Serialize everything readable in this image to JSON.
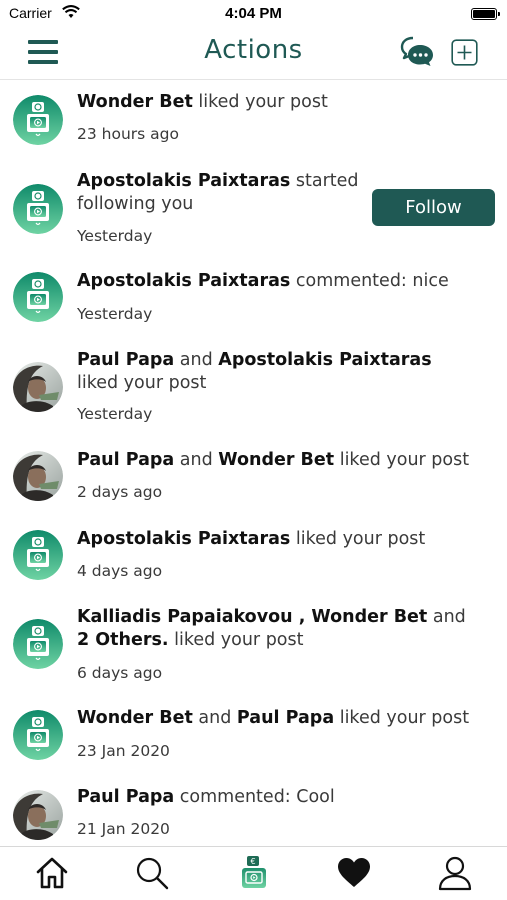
{
  "status_bar": {
    "carrier": "Carrier",
    "time": "4:04 PM"
  },
  "nav": {
    "title": "Actions"
  },
  "notifications": [
    {
      "avatar": "app-logo",
      "parts": [
        {
          "text": "Wonder Bet",
          "bold": true
        },
        {
          "text": " liked your post",
          "bold": false
        }
      ],
      "time": "23 hours ago"
    },
    {
      "avatar": "app-logo",
      "parts": [
        {
          "text": "Apostolakis Paixtaras",
          "bold": true
        },
        {
          "text": " started following you",
          "bold": false
        }
      ],
      "time": "Yesterday",
      "action": "Follow"
    },
    {
      "avatar": "app-logo",
      "parts": [
        {
          "text": "Apostolakis Paixtaras",
          "bold": true
        },
        {
          "text": " commented: nice",
          "bold": false
        }
      ],
      "time": "Yesterday"
    },
    {
      "avatar": "user-photo",
      "parts": [
        {
          "text": "Paul Papa",
          "bold": true
        },
        {
          "text": " and ",
          "bold": false
        },
        {
          "text": "Apostolakis Paixtaras",
          "bold": true
        },
        {
          "text": " liked your post",
          "bold": false
        }
      ],
      "time": "Yesterday"
    },
    {
      "avatar": "user-photo",
      "parts": [
        {
          "text": "Paul Papa",
          "bold": true
        },
        {
          "text": " and ",
          "bold": false
        },
        {
          "text": "Wonder Bet",
          "bold": true
        },
        {
          "text": " liked your post",
          "bold": false
        }
      ],
      "time": "2 days ago"
    },
    {
      "avatar": "app-logo",
      "parts": [
        {
          "text": "Apostolakis Paixtaras",
          "bold": true
        },
        {
          "text": " liked your post",
          "bold": false
        }
      ],
      "time": "4 days ago"
    },
    {
      "avatar": "app-logo",
      "parts": [
        {
          "text": "Kalliadis Papaiakovou , Wonder Bet",
          "bold": true
        },
        {
          "text": " and ",
          "bold": false
        },
        {
          "text": "2 Others.",
          "bold": true
        },
        {
          "text": " liked your post",
          "bold": false
        }
      ],
      "time": "6 days ago"
    },
    {
      "avatar": "app-logo",
      "parts": [
        {
          "text": "Wonder Bet",
          "bold": true
        },
        {
          "text": " and ",
          "bold": false
        },
        {
          "text": "Paul Papa",
          "bold": true
        },
        {
          "text": " liked your post",
          "bold": false
        }
      ],
      "time": "23 Jan 2020"
    },
    {
      "avatar": "user-photo",
      "parts": [
        {
          "text": "Paul Papa",
          "bold": true
        },
        {
          "text": " commented: Cool",
          "bold": false
        }
      ],
      "time": "21 Jan 2020"
    }
  ],
  "tab_bar": {
    "tabs": [
      {
        "icon": "home-icon"
      },
      {
        "icon": "search-icon"
      },
      {
        "icon": "app-logo-icon",
        "active": true
      },
      {
        "icon": "heart-icon"
      },
      {
        "icon": "profile-icon"
      }
    ]
  },
  "colors": {
    "accent": "#1f5954",
    "logo_green": "#1fa37a",
    "logo_green_light": "#6ed6a4"
  }
}
